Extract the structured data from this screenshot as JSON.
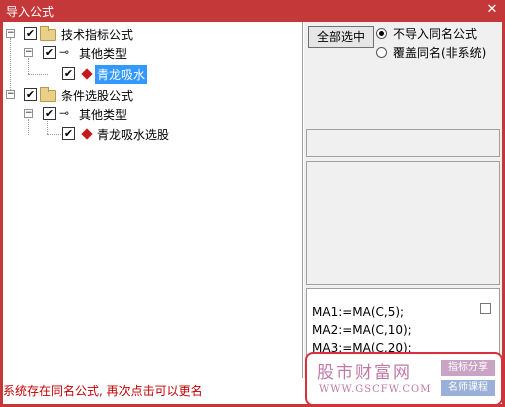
{
  "window": {
    "title": "导入公式",
    "close_glyph": "✕"
  },
  "tree": {
    "nodes": [
      {
        "label": "技术指标公式",
        "checked": true,
        "icon": "folder-icon",
        "expander": "−"
      },
      {
        "label": "其他类型",
        "checked": true,
        "icon": "key-icon",
        "expander": "−"
      },
      {
        "label": "青龙吸水",
        "checked": true,
        "icon": "formula-gem-icon",
        "selected": true
      },
      {
        "label": "条件选股公式",
        "checked": true,
        "icon": "folder-icon",
        "expander": "−"
      },
      {
        "label": "其他类型",
        "checked": true,
        "icon": "key-icon",
        "expander": "−"
      },
      {
        "label": "青龙吸水选股",
        "checked": true,
        "icon": "formula-gem-icon"
      }
    ],
    "check_glyph": "✔",
    "key_glyph": "⊸"
  },
  "options": {
    "select_all_label": "全部选中",
    "radio_skip_label": "不导入同名公式",
    "radio_overwrite_label": "覆盖同名(非系统)",
    "selected_radio": "skip"
  },
  "code": {
    "lines": [
      "MA1:=MA(C,5);",
      "MA2:=MA(C,10);",
      "MA3:=MA(C,20);"
    ]
  },
  "watermark": {
    "brand": "股市财富网",
    "url": "WWW.GSCFW.COM",
    "tag1": "指标分享",
    "tag2": "名师课程"
  },
  "status": {
    "message": "系统存在同名公式, 再次点击可以更名"
  },
  "colors": {
    "frame": "#c4383a",
    "selection": "#3399ff",
    "status_text": "#c00000"
  }
}
